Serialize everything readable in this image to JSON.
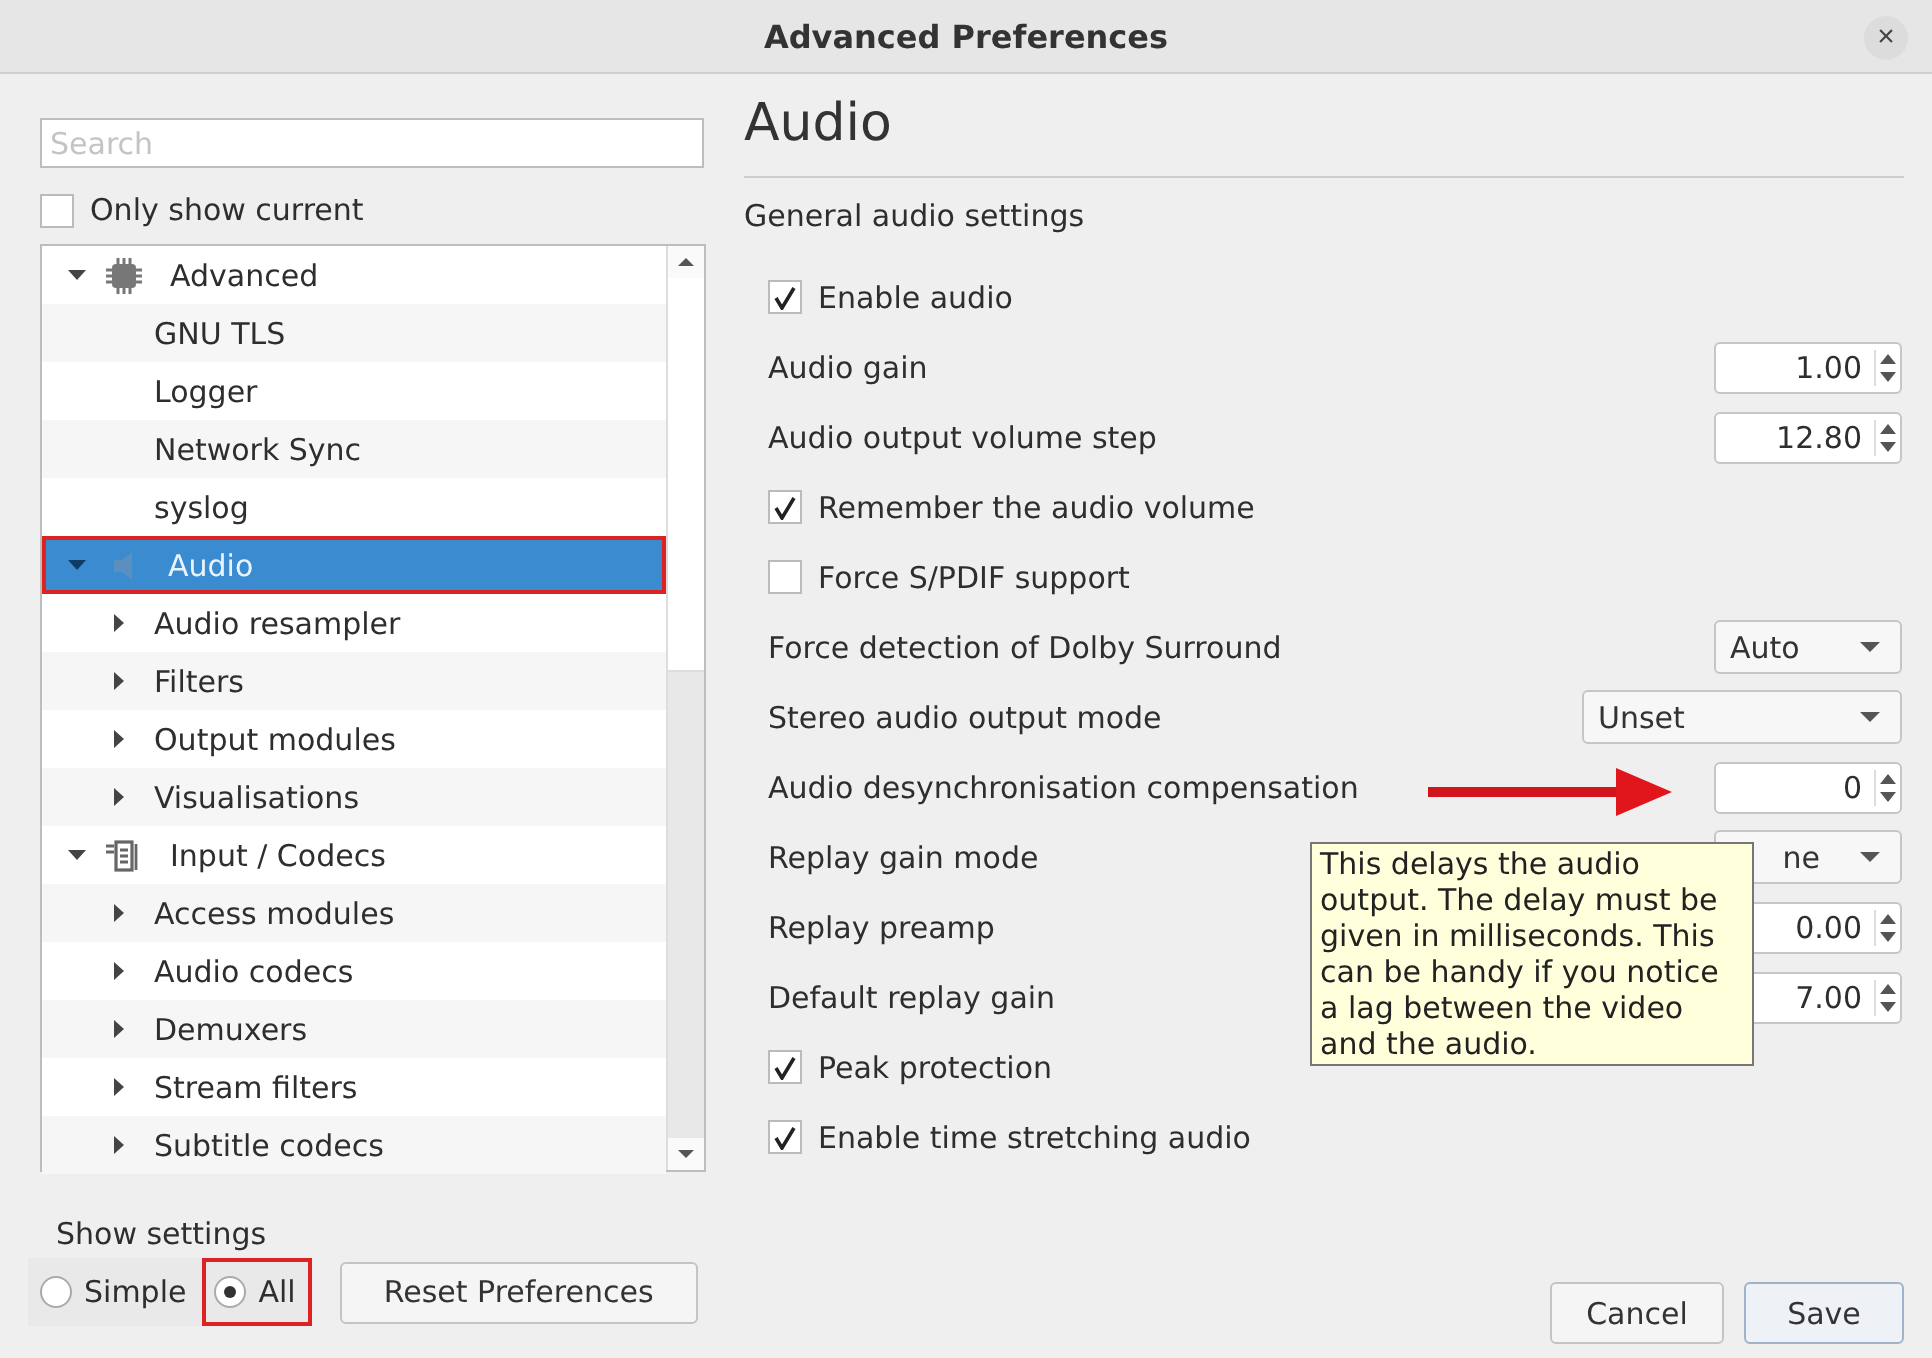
{
  "window": {
    "title": "Advanced Preferences",
    "close": "×"
  },
  "search": {
    "placeholder": "Search"
  },
  "only_show_current": {
    "label": "Only show current",
    "checked": false
  },
  "tree": [
    {
      "label": "Advanced",
      "kind": "chip",
      "expanded": true,
      "selected": false,
      "annotation_frame": false,
      "children": [
        {
          "label": "GNU TLS",
          "selected": false
        },
        {
          "label": "Logger",
          "selected": false
        },
        {
          "label": "Network Sync",
          "selected": false
        },
        {
          "label": "syslog",
          "selected": false
        }
      ]
    },
    {
      "label": "Audio",
      "kind": "speaker",
      "expanded": true,
      "selected": true,
      "annotation_frame": true,
      "children": [
        {
          "label": "Audio resampler",
          "expanded": false,
          "selected": false
        },
        {
          "label": "Filters",
          "expanded": false,
          "selected": false
        },
        {
          "label": "Output modules",
          "expanded": false,
          "selected": false
        },
        {
          "label": "Visualisations",
          "expanded": false,
          "selected": false
        }
      ]
    },
    {
      "label": "Input / Codecs",
      "kind": "codec",
      "expanded": true,
      "selected": false,
      "annotation_frame": false,
      "children": [
        {
          "label": "Access modules",
          "expanded": false,
          "selected": false
        },
        {
          "label": "Audio codecs",
          "expanded": false,
          "selected": false
        },
        {
          "label": "Demuxers",
          "expanded": false,
          "selected": false
        },
        {
          "label": "Stream filters",
          "expanded": false,
          "selected": false
        },
        {
          "label": "Subtitle codecs",
          "expanded": false,
          "selected": false
        }
      ]
    }
  ],
  "show_settings": {
    "label": "Show settings",
    "options": [
      {
        "label": "Simple",
        "selected": false,
        "annotation_frame": false
      },
      {
        "label": "All",
        "selected": true,
        "annotation_frame": true
      }
    ]
  },
  "reset_button": "Reset Preferences",
  "panel": {
    "title": "Audio",
    "section": "General audio settings",
    "settings": [
      {
        "kind": "checkbox",
        "label": "Enable audio",
        "checked": true
      },
      {
        "kind": "spin",
        "label": "Audio gain",
        "value": "1.00"
      },
      {
        "kind": "spin",
        "label": "Audio output volume step",
        "value": "12.80"
      },
      {
        "kind": "checkbox",
        "label": "Remember the audio volume",
        "checked": true
      },
      {
        "kind": "checkbox",
        "label": "Force S/PDIF support",
        "checked": false
      },
      {
        "kind": "combo",
        "label": "Force detection of Dolby Surround",
        "value": "Auto",
        "value_clipped": false
      },
      {
        "kind": "combo",
        "label": "Stereo audio output mode",
        "value": "Unset",
        "value_clipped": false
      },
      {
        "kind": "spin",
        "label": "Audio desynchronisation compensation",
        "value": "0"
      },
      {
        "kind": "combo",
        "label": "Replay gain mode",
        "value": "ne",
        "value_clipped": true
      },
      {
        "kind": "spin",
        "label": "Replay preamp",
        "value": "0.00"
      },
      {
        "kind": "spin",
        "label": "Default replay gain",
        "value": "7.00"
      },
      {
        "kind": "checkbox",
        "label": "Peak protection",
        "checked": true
      },
      {
        "kind": "checkbox",
        "label": "Enable time stretching audio",
        "checked": true
      }
    ]
  },
  "tooltip": "This delays the audio output. The delay must be given in milliseconds. This can be handy if you notice a lag between the video and the audio.",
  "buttons": [
    {
      "label": "Cancel",
      "kind": "normal"
    },
    {
      "label": "Save",
      "kind": "default"
    }
  ]
}
